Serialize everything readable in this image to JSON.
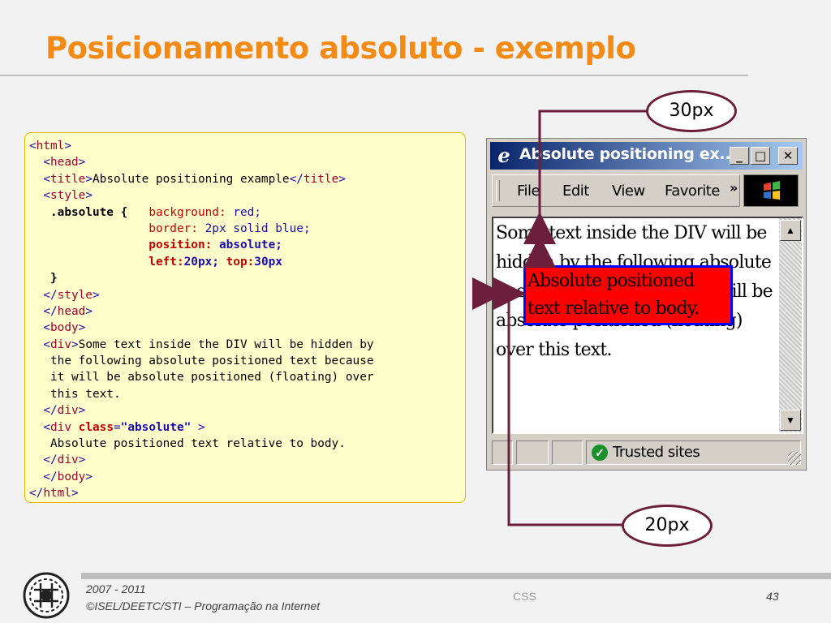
{
  "slide": {
    "title": "Posicionamento absoluto - exemplo"
  },
  "code": {
    "lines": [
      [
        [
          "br",
          "<"
        ],
        [
          "kw",
          "html"
        ],
        [
          "br",
          ">"
        ]
      ],
      [
        [
          "",
          "  "
        ],
        [
          "br",
          "<"
        ],
        [
          "kw",
          "head"
        ],
        [
          "br",
          ">"
        ]
      ],
      [
        [
          "",
          "  "
        ],
        [
          "br",
          "<"
        ],
        [
          "kw",
          "title"
        ],
        [
          "br",
          ">"
        ],
        [
          "",
          "Absolute positioning example"
        ],
        [
          "br",
          "</"
        ],
        [
          "kw",
          "title"
        ],
        [
          "br",
          ">"
        ]
      ],
      [
        [
          "",
          "  "
        ],
        [
          "br",
          "<"
        ],
        [
          "kw",
          "style"
        ],
        [
          "br",
          ">"
        ]
      ],
      [
        [
          "",
          "   "
        ],
        [
          "b",
          ".absolute"
        ],
        [
          "",
          " "
        ],
        [
          "b",
          "{"
        ],
        [
          "",
          "   "
        ],
        [
          "prop",
          "background:"
        ],
        [
          "",
          " "
        ],
        [
          "val",
          "red;"
        ]
      ],
      [
        [
          "",
          "                 "
        ],
        [
          "prop",
          "border:"
        ],
        [
          "",
          " "
        ],
        [
          "val",
          "2px solid blue;"
        ]
      ],
      [
        [
          "",
          "                 "
        ],
        [
          "prop b",
          "position:"
        ],
        [
          "",
          " "
        ],
        [
          "val b",
          "absolute;"
        ]
      ],
      [
        [
          "",
          "                 "
        ],
        [
          "prop b",
          "left:"
        ],
        [
          "val b",
          "20px;"
        ],
        [
          "",
          " "
        ],
        [
          "prop b",
          "top:"
        ],
        [
          "val b",
          "30px"
        ]
      ],
      [
        [
          "",
          "   "
        ],
        [
          "b",
          "}"
        ]
      ],
      [
        [
          "",
          "  "
        ],
        [
          "br",
          "</"
        ],
        [
          "kw",
          "style"
        ],
        [
          "br",
          ">"
        ]
      ],
      [
        [
          "",
          "  "
        ],
        [
          "br",
          "</"
        ],
        [
          "kw",
          "head"
        ],
        [
          "br",
          ">"
        ]
      ],
      [
        [
          "",
          "  "
        ],
        [
          "br",
          "<"
        ],
        [
          "kw",
          "body"
        ],
        [
          "br",
          ">"
        ]
      ],
      [
        [
          "",
          "  "
        ],
        [
          "br",
          "<"
        ],
        [
          "kw",
          "div"
        ],
        [
          "br",
          ">"
        ],
        [
          "",
          "Some text inside the DIV will be hidden by"
        ]
      ],
      [
        [
          "",
          "   the following absolute positioned text because"
        ]
      ],
      [
        [
          "",
          "   it will be absolute positioned (floating) over"
        ]
      ],
      [
        [
          "",
          "   this text."
        ]
      ],
      [
        [
          "",
          "  "
        ],
        [
          "br",
          "</"
        ],
        [
          "kw",
          "div"
        ],
        [
          "br",
          ">"
        ]
      ],
      [
        [
          "",
          "  "
        ],
        [
          "br",
          "<"
        ],
        [
          "kw",
          "div"
        ],
        [
          "",
          " "
        ],
        [
          "prop b",
          "class"
        ],
        [
          "br",
          "="
        ],
        [
          "val b",
          "\"absolute\""
        ],
        [
          "",
          " "
        ],
        [
          "br",
          ">"
        ]
      ],
      [
        [
          "",
          "   Absolute positioned text relative to body."
        ]
      ],
      [
        [
          "",
          "  "
        ],
        [
          "br",
          "</"
        ],
        [
          "kw",
          "div"
        ],
        [
          "br",
          ">"
        ]
      ],
      [
        [
          "",
          "  "
        ],
        [
          "br",
          "</"
        ],
        [
          "kw",
          "body"
        ],
        [
          "br",
          ">"
        ]
      ],
      [
        [
          "br",
          "</"
        ],
        [
          "kw",
          "html"
        ],
        [
          "br",
          ">"
        ]
      ]
    ]
  },
  "browser": {
    "window_title": "Absolute positioning ex...",
    "menu": [
      {
        "name": "menu-file",
        "label": "File"
      },
      {
        "name": "menu-edit",
        "label": "Edit"
      },
      {
        "name": "menu-view",
        "label": "View"
      },
      {
        "name": "menu-favorites",
        "label": "Favorite"
      }
    ],
    "more_menu_label": "»",
    "page_text": "Some text inside the DIV will be hidden by the following absolute positioned text because it will be absolute positioned (floating) over this text.",
    "absolute_text": "Absolute positioned text relative to body.",
    "status_zone": "Trusted sites",
    "icons": {
      "app": "internet-explorer-icon",
      "minimize": "minimize-icon",
      "maximize": "maximize-icon",
      "close": "close-icon",
      "throbber": "windows-logo-icon",
      "zone": "trusted-sites-check-icon",
      "scroll_up": "scroll-up-icon",
      "scroll_down": "scroll-down-icon"
    }
  },
  "annotations": {
    "top_label": "30px",
    "left_label": "20px",
    "color": "#6b1f3a"
  },
  "footer": {
    "years": "2007 - 2011",
    "copyright": "©ISEL/DEETC/STI – Programação na Internet",
    "topic": "CSS",
    "page_number": "43"
  },
  "colors": {
    "title": "#f28a16",
    "code_background": "#ffffcc",
    "absolute_background": "#ff0000",
    "absolute_border": "#0000ff"
  }
}
